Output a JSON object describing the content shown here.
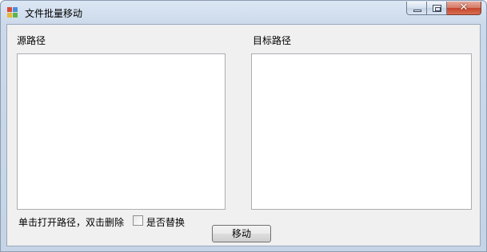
{
  "window": {
    "title": "文件批量移动",
    "close_glyph": "✕"
  },
  "form": {
    "source_label": "源路径",
    "target_label": "目标路径",
    "hint": "单击打开路径，双击删除",
    "replace_checkbox": {
      "label": "是否替换",
      "checked": false
    },
    "move_button": "移动"
  },
  "colors": {
    "client_bg": "#f0f0f0",
    "titlebar": "#dce7f4",
    "close_button": "#c5442c"
  }
}
